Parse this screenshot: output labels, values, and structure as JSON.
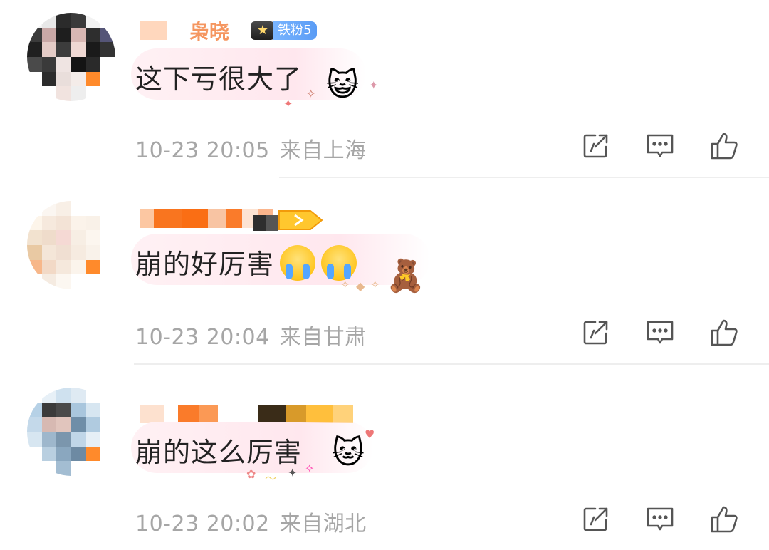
{
  "comments": [
    {
      "username": "枭晓",
      "fan_badge": "铁粉5",
      "text": "这下亏很大了",
      "emojis": [],
      "time": "10-23 20:05",
      "location": "来自上海"
    },
    {
      "username": "",
      "fan_badge": "",
      "text": "崩的好厉害",
      "emojis": [
        "crying-face",
        "crying-face"
      ],
      "time": "10-23 20:04",
      "location": "来自甘肃"
    },
    {
      "username": "",
      "fan_badge": "",
      "text": "崩的这么厉害",
      "emojis": [],
      "time": "10-23 20:02",
      "location": "来自湖北"
    }
  ],
  "icons": {
    "share": "share-icon",
    "reply": "comment-icon",
    "like": "thumbs-up-icon"
  },
  "colors": {
    "accent_orange": "#ff8200",
    "meta_gray": "#a6a6a6",
    "fan_badge_blue": "#5a9cf5"
  }
}
